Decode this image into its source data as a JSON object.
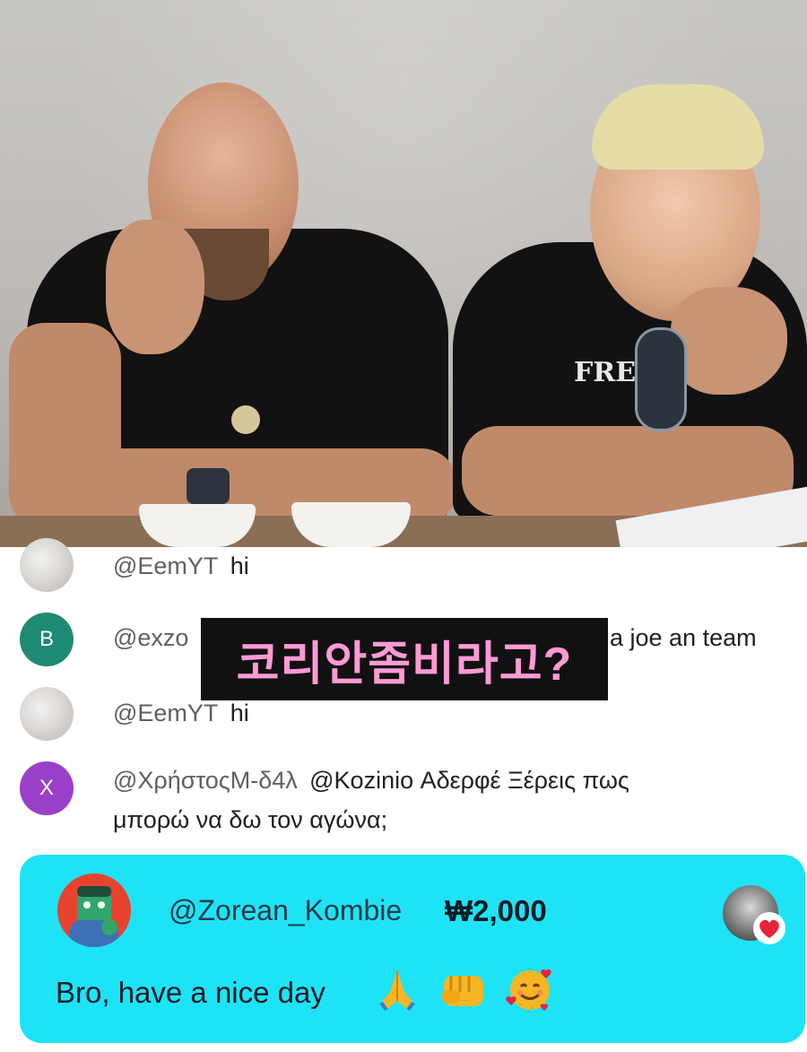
{
  "subtitle": "코리안좀비라고?",
  "chat": [
    {
      "avatar_type": "photo",
      "handle": "@EemYT",
      "message": "hi"
    },
    {
      "avatar_type": "letter",
      "avatar_letter": "B",
      "avatar_color": "#1f8a73",
      "handle": "@exzo",
      "message": "a joe an team"
    },
    {
      "avatar_type": "photo",
      "handle": "@EemYT",
      "message": "hi"
    },
    {
      "avatar_type": "letter",
      "avatar_letter": "X",
      "avatar_color": "#9a3fc7",
      "handle": "@ΧρήστοςΜ-δ4λ",
      "message_line1": "@Kozinio Αδερφέ Ξέρεις πως",
      "message_line2": "μπορώ να δω τον αγώνα;"
    }
  ],
  "superchat": {
    "background": "#1ee3f7",
    "handle": "@Zorean_Kombie",
    "amount": "₩2,000",
    "message": "Bro, have a nice day",
    "emojis": [
      "folded-hands-icon",
      "fist-icon",
      "smiling-hearts-icon"
    ],
    "badge": "creator-heart-icon"
  },
  "video": {
    "shirt_text": "FREESTYLE"
  }
}
